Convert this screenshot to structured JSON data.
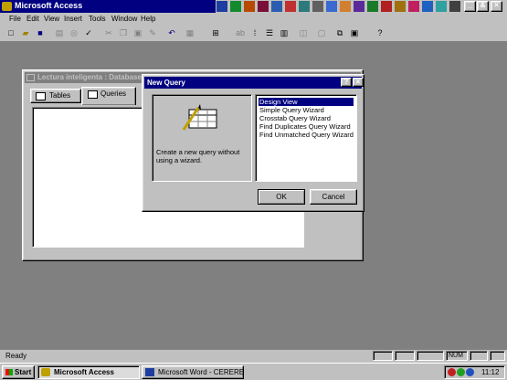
{
  "app": {
    "title": "Microsoft Access",
    "window_buttons": [
      "_",
      "&",
      "×"
    ]
  },
  "menu": [
    "File",
    "Edit",
    "View",
    "Insert",
    "Tools",
    "Window",
    "Help"
  ],
  "database_window": {
    "title": "Lectura inteligenta : Database",
    "tabs": [
      "Tables",
      "Queries"
    ]
  },
  "dialog": {
    "title": "New Query",
    "description": "Create a new query without using a wizard.",
    "options": [
      "Design View",
      "Simple Query Wizard",
      "Crosstab Query Wizard",
      "Find Duplicates Query Wizard",
      "Find Unmatched Query Wizard"
    ],
    "selected_option": "Design View",
    "ok_label": "OK",
    "cancel_label": "Cancel",
    "help_glyph": "?",
    "close_glyph": "×"
  },
  "status": {
    "text": "Ready",
    "num": "NUM"
  },
  "taskbar": {
    "start_label": "Start",
    "tasks": [
      "Microsoft Access",
      "Microsoft Word - CERERE..."
    ],
    "active_task": "Microsoft Access",
    "clock": "11:12"
  },
  "colors": {
    "title_active": "#000080",
    "title_inactive": "#808080",
    "face": "#c0c0c0",
    "desktop": "#808080"
  }
}
